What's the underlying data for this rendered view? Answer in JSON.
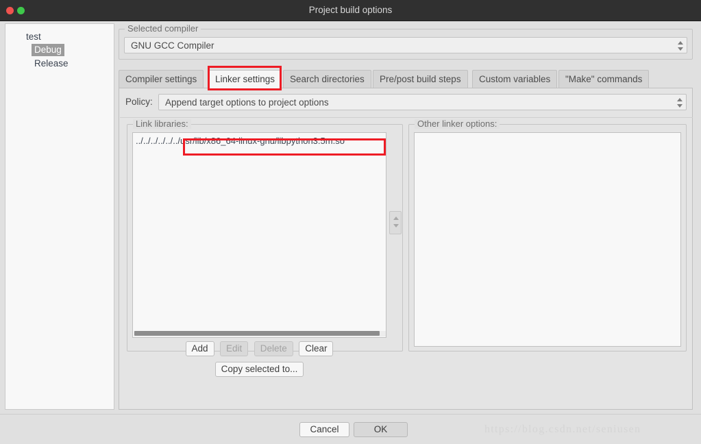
{
  "window": {
    "title": "Project build options",
    "close_label": "",
    "minmax_label": ""
  },
  "sidebar": {
    "items": [
      {
        "label": "test",
        "level": 0,
        "selected": false
      },
      {
        "label": "Debug",
        "level": 1,
        "selected": true
      },
      {
        "label": "Release",
        "level": 1,
        "selected": false
      }
    ]
  },
  "compiler_group": {
    "title": "Selected compiler",
    "selected": "GNU GCC Compiler"
  },
  "tabs": [
    {
      "label": "Compiler settings",
      "active": false
    },
    {
      "label": "Linker settings",
      "active": true
    },
    {
      "label": "Search directories",
      "active": false
    },
    {
      "label": "Pre/post build steps",
      "active": false
    },
    {
      "label": "Custom variables",
      "active": false
    },
    {
      "label": "\"Make\" commands",
      "active": false
    }
  ],
  "policy": {
    "label": "Policy:",
    "value": "Append target options to project options"
  },
  "link_libraries": {
    "title": "Link libraries:",
    "entries": [
      "../../../../../../usr/lib/x86_64-linux-gnu/libpython3.5m.so"
    ],
    "buttons": [
      {
        "label": "Add",
        "enabled": true
      },
      {
        "label": "Edit",
        "enabled": false
      },
      {
        "label": "Delete",
        "enabled": false
      },
      {
        "label": "Clear",
        "enabled": true
      }
    ],
    "copy_button": "Copy selected to..."
  },
  "other_linker_options": {
    "title": "Other linker options:",
    "value": ""
  },
  "footer": {
    "cancel_label": "Cancel",
    "ok_label": "OK"
  },
  "watermark": "https://blog.csdn.net/seniusen",
  "colors": {
    "annotation_red": "#ee1c25",
    "titlebar_bg": "#303030",
    "dialog_bg": "#e0e0e0",
    "selection_bg": "#9b9b9b",
    "close_button": "#f0534f",
    "minmax_button": "#3fc94b"
  }
}
